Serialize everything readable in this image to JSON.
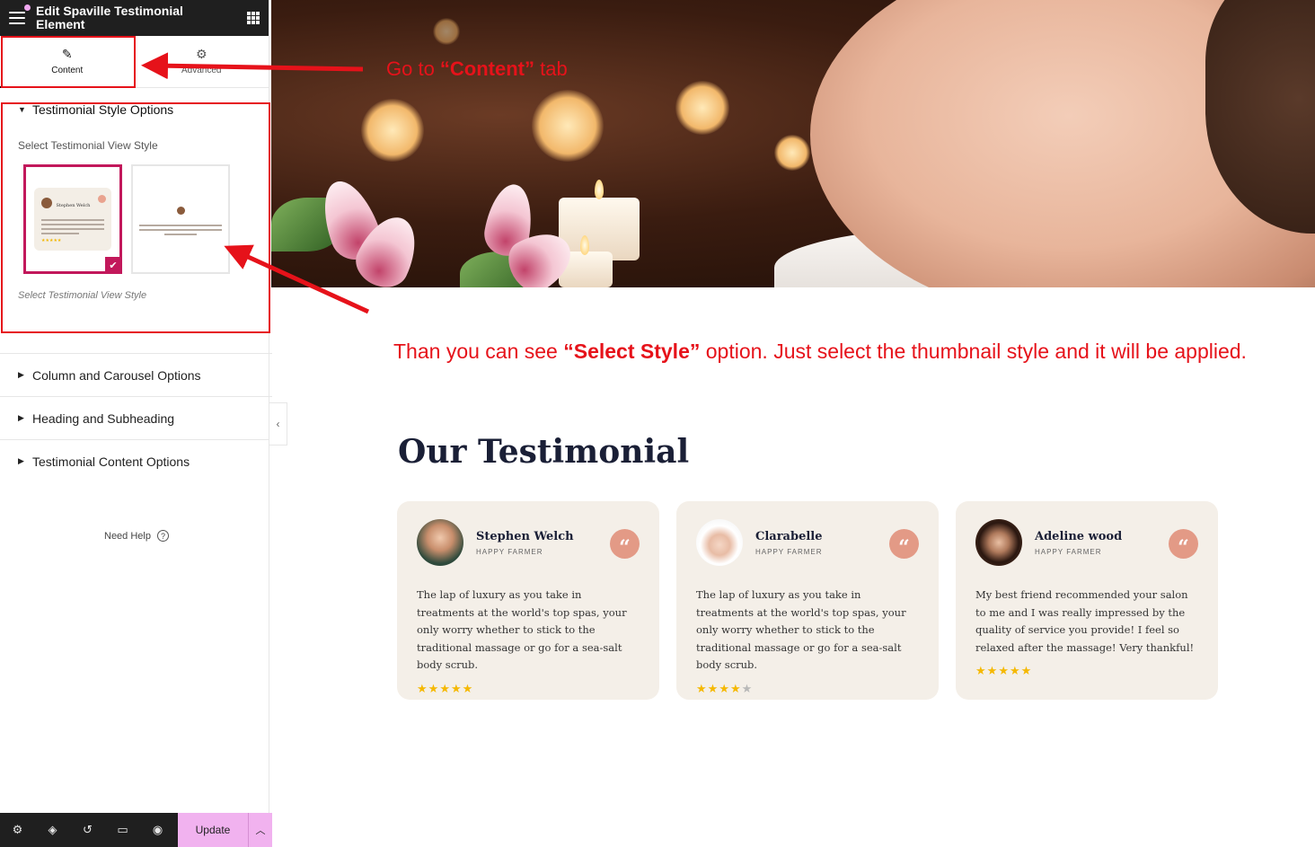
{
  "sidebar": {
    "title": "Edit Spaville Testimonial Element",
    "tabs": [
      {
        "label": "Content",
        "icon": "pencil-icon",
        "active": true
      },
      {
        "label": "Advanced",
        "icon": "gear-icon",
        "active": false
      }
    ],
    "style_section": {
      "title": "Testimonial Style Options",
      "label": "Select Testimonial View Style",
      "hint": "Select Testimonial View Style",
      "thumbnails": [
        {
          "name": "Style 1",
          "selected": true,
          "mini_name": "Stephen Welch"
        },
        {
          "name": "Style 2",
          "selected": false
        }
      ]
    },
    "sections": [
      {
        "title": "Column and Carousel Options"
      },
      {
        "title": "Heading and Subheading"
      },
      {
        "title": "Testimonial Content Options"
      }
    ],
    "need_help": "Need Help",
    "update_label": "Update"
  },
  "annotations": {
    "step1_prefix": "Go  to ",
    "step1_bold": "“Content”",
    "step1_suffix": " tab",
    "step2_prefix": "Than you can see ",
    "step2_bold": "“Select Style”",
    "step2_suffix": " option. Just select the thumbnail style and it will be applied.",
    "color": "#e6121a"
  },
  "testimonial": {
    "heading": "Our Testimonial",
    "cards": [
      {
        "name": "Stephen Welch",
        "role": "HAPPY FARMER",
        "text": "The lap of luxury as you take in treatments at the world's top spas, your only worry whether to stick to the traditional massage or go for a sea-salt body scrub.",
        "rating": 5
      },
      {
        "name": "Clarabelle",
        "role": "HAPPY FARMER",
        "text": "The lap of luxury as you take in treatments at the world's top spas, your only worry whether to stick to the traditional massage or go for a sea-salt body scrub.",
        "rating": 4
      },
      {
        "name": "Adeline wood",
        "role": "HAPPY FARMER",
        "text": "My best friend recommended your salon to me and I was really impressed by the quality of service you provide! I feel so relaxed after the massage! Very thankful!",
        "rating": 5
      }
    ]
  },
  "colors": {
    "accent": "#c2185b",
    "update_bg": "#f1b2ef",
    "card_bg": "#f4efe8",
    "quote_bg": "#e39a86",
    "star": "#f5b800"
  }
}
